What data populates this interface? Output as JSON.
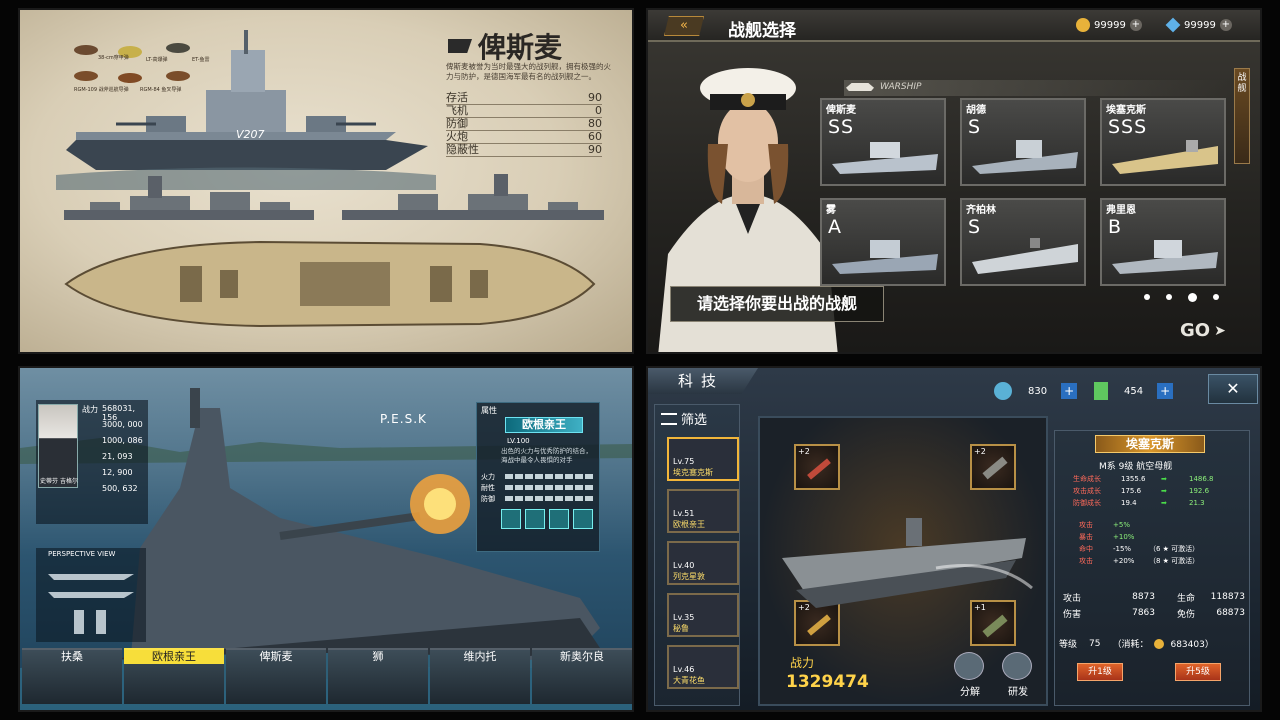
{
  "panel1": {
    "ship_name": "俾斯麦",
    "description": "俾斯麦被誉为当时最强大的战列舰，拥有极强的火力与防护，是德国海军最有名的战列舰之一。",
    "stats": [
      {
        "label": "存活",
        "value": "90"
      },
      {
        "label": "飞机",
        "value": "0"
      },
      {
        "label": "防御",
        "value": "80"
      },
      {
        "label": "火炮",
        "value": "60"
      },
      {
        "label": "隐蔽性",
        "value": "90"
      }
    ],
    "ammo_labels": [
      "38-cm穿甲弹",
      "LT-高爆弹",
      "RGM-109 战斧巡航导弹",
      "RGM-84 鱼叉导弹",
      "ET-鱼雷"
    ],
    "hull_number": "V207"
  },
  "panel2": {
    "title": "战舰选择",
    "currency1": "99999",
    "currency2": "99999",
    "banner": "WARSHIP",
    "side_tab": "战舰",
    "ships": [
      {
        "name": "俾斯麦",
        "grade": "SS"
      },
      {
        "name": "胡德",
        "grade": "S"
      },
      {
        "name": "埃塞克斯",
        "grade": "SSS"
      },
      {
        "name": "雾",
        "grade": "A"
      },
      {
        "name": "齐柏林",
        "grade": "S"
      },
      {
        "name": "弗里恩",
        "grade": "B"
      }
    ],
    "prompt": "请选择你要出战的战舰",
    "go": "GO"
  },
  "panel3": {
    "power_label": "战力",
    "power": "568031, 156",
    "stats": [
      "3000, 000",
      "1000, 086",
      "21, 093",
      "12, 900",
      "500, 632"
    ],
    "commander": "史蒂芬 吉格尔",
    "ship_code": "P.E.S.K",
    "attr_label": "属性",
    "ship_name": "欧根亲王",
    "lv": "LV.100",
    "desc": "出色的火力与优秀防护的结合，海战中最令人畏惧的对手",
    "bars": [
      "火力",
      "耐性",
      "防御"
    ],
    "perspective": "PERSPECTIVE VIEW",
    "tabs": [
      "扶桑",
      "欧根亲王",
      "俾斯麦",
      "狮",
      "维内托",
      "新奥尔良"
    ]
  },
  "panel4": {
    "title": "科技",
    "res1": "830",
    "res2": "454",
    "filter": "筛选",
    "list": [
      {
        "lv": "Lv.75",
        "name": "埃克塞克斯",
        "stars": "★★★★★"
      },
      {
        "lv": "Lv.51",
        "name": "欧根亲王",
        "stars": "★★★★"
      },
      {
        "lv": "Lv.40",
        "name": "列克星敦",
        "stars": "★★★"
      },
      {
        "lv": "Lv.35",
        "name": "秘鲁",
        "stars": "★★★★★"
      },
      {
        "lv": "Lv.46",
        "name": "大青花鱼",
        "stars": "★★"
      }
    ],
    "items": [
      "+2",
      "+2",
      "+2",
      "+1"
    ],
    "ship_name": "埃塞克斯",
    "ship_class": "M系 9级 航空母舰",
    "growth": [
      {
        "label": "生命成长",
        "from": "1355.6",
        "to": "1486.8"
      },
      {
        "label": "攻击成长",
        "from": "175.6",
        "to": "192.6"
      },
      {
        "label": "防御成长",
        "from": "19.4",
        "to": "21.3"
      }
    ],
    "bonus": [
      {
        "label": "攻击",
        "value": "+5%"
      },
      {
        "label": "暴击",
        "value": "+10%"
      },
      {
        "label": "命中",
        "value": "-15%",
        "note": "（6 ★ 可激活）"
      },
      {
        "label": "攻击",
        "value": "+20%",
        "note": "（8 ★ 可激活）"
      }
    ],
    "combat": [
      {
        "label": "攻击",
        "value": "8873"
      },
      {
        "label": "生命",
        "value": "118873"
      },
      {
        "label": "伤害",
        "value": "7863"
      },
      {
        "label": "免伤",
        "value": "68873"
      }
    ],
    "level_label": "等级",
    "level": "75",
    "cost": "（消耗：",
    "cost_value": "683403）",
    "btn1": "升1级",
    "btn5": "升5级",
    "power_label": "战力",
    "power": "1329474",
    "act1": "分解",
    "act2": "研发"
  }
}
